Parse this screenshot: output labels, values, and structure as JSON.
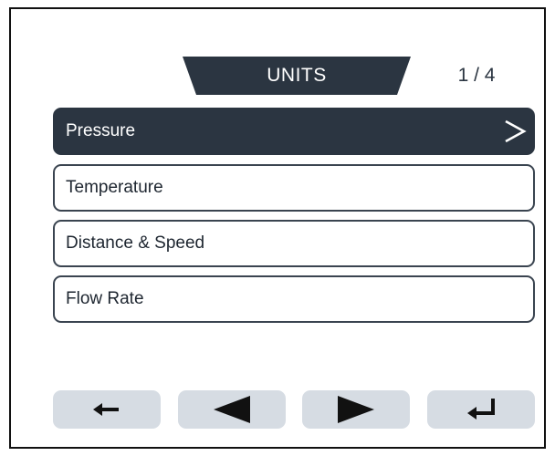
{
  "header": {
    "title": "UNITS",
    "page_indicator": "1 / 4"
  },
  "menu": {
    "items": [
      {
        "label": "Pressure",
        "selected": true,
        "icon": "chevron-right-icon"
      },
      {
        "label": "Temperature",
        "selected": false
      },
      {
        "label": "Distance & Speed",
        "selected": false
      },
      {
        "label": "Flow Rate",
        "selected": false
      }
    ]
  },
  "nav": {
    "buttons": [
      {
        "icon": "back-arrow-icon"
      },
      {
        "icon": "triangle-left-icon"
      },
      {
        "icon": "triangle-right-icon"
      },
      {
        "icon": "enter-icon"
      }
    ]
  },
  "colors": {
    "primary_dark": "#2b3541",
    "button_bg": "#d6dce3",
    "border": "#3a4450",
    "background": "#ffffff"
  }
}
